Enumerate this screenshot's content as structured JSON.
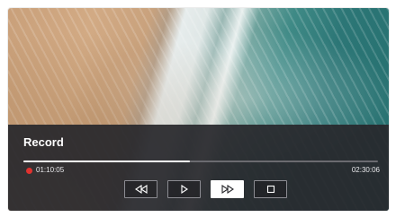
{
  "player": {
    "title": "Record",
    "progress": 0.47,
    "current_time": "01:10:05",
    "total_time": "02:30:06",
    "recording_color": "#e0322f",
    "controls": [
      {
        "icon": "rewind-icon",
        "active": false
      },
      {
        "icon": "play-icon",
        "active": false
      },
      {
        "icon": "fast-forward-icon",
        "active": true
      },
      {
        "icon": "stop-icon",
        "active": false
      }
    ]
  }
}
